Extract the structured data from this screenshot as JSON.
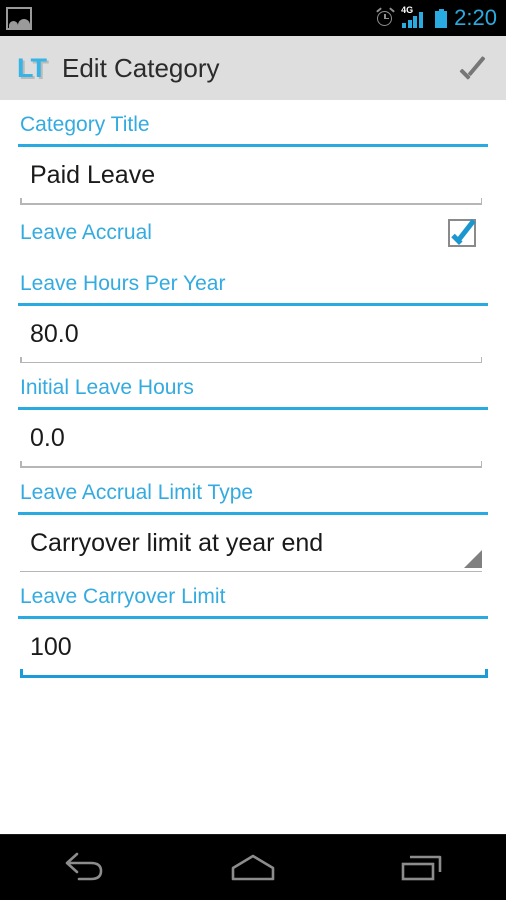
{
  "status_bar": {
    "notification_icon": "gallery-icon",
    "alarm_icon": "alarm-clock-icon",
    "network_label": "4G",
    "signal_icon": "signal-bars-icon",
    "battery_icon": "battery-icon",
    "time": "2:20",
    "time_color": "#29ABE2"
  },
  "action_bar": {
    "logo_text": "LT",
    "logo_color": "#36B4E5",
    "title": "Edit Category",
    "background": "#dedede",
    "done_action": "done-checkmark"
  },
  "form": {
    "accent_color": "#29ABE2",
    "fields": [
      {
        "label": "Category Title",
        "value": "Paid Leave",
        "type": "text",
        "focused": false
      },
      {
        "label": "Leave Accrual",
        "type": "checkbox",
        "checked": true
      },
      {
        "label": "Leave Hours Per Year",
        "value": "80.0",
        "type": "number",
        "focused": false
      },
      {
        "label": "Initial Leave Hours",
        "value": "0.0",
        "type": "number",
        "focused": false
      },
      {
        "label": "Leave Accrual Limit Type",
        "value": "Carryover limit at year end",
        "type": "spinner",
        "focused": false
      },
      {
        "label": "Leave Carryover Limit",
        "value": "100",
        "type": "number",
        "focused": true
      }
    ]
  },
  "nav_bar": {
    "back": "back-icon",
    "home": "home-icon",
    "recents": "recents-icon"
  }
}
